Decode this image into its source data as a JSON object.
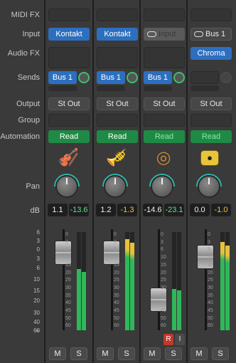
{
  "labels": {
    "midi_fx": "MIDI FX",
    "input": "Input",
    "audio_fx": "Audio FX",
    "sends": "Sends",
    "output": "Output",
    "group": "Group",
    "automation": "Automation",
    "pan": "Pan",
    "db": "dB"
  },
  "scale_marks": [
    "6",
    "3",
    "0",
    "3",
    "6",
    "10",
    "15",
    "20",
    "30",
    "40",
    "60",
    "∞"
  ],
  "fader_scale": [
    "0",
    "3",
    "6",
    "10",
    "15",
    "20",
    "25",
    "30",
    "35",
    "40",
    "45",
    "50",
    "60"
  ],
  "strips": [
    {
      "input": "Kontakt",
      "send": "Bus 1",
      "output": "St Out",
      "automation": "Read",
      "instrument_icon": "violin-icon",
      "volume": "1.1",
      "peak": "-13.6",
      "peak_color": "green",
      "fader_level_db": 1.1,
      "meter_level": 0.62,
      "mute": "M",
      "solo": "S"
    },
    {
      "input": "Kontakt",
      "send": "Bus 1",
      "output": "St Out",
      "automation": "Read",
      "instrument_icon": "brass-icon",
      "volume": "1.2",
      "peak": "-1.3",
      "peak_color": "yellow",
      "fader_level_db": 1.2,
      "meter_level": 0.93,
      "mute": "M",
      "solo": "S"
    },
    {
      "input": "Input",
      "send": "Bus 1",
      "output": "St Out",
      "automation": "Read",
      "instrument_icon": "tambourine-icon",
      "volume": "-14.6",
      "peak": "-23.1",
      "peak_color": "green",
      "fader_level_db": -14.6,
      "meter_level": 0.42,
      "record": "R",
      "input_monitor": "I",
      "mute": "M",
      "solo": "S"
    },
    {
      "input": "Bus 1",
      "audio_fx": "Chroma",
      "output": "St Out",
      "automation": "Read",
      "instrument_icon": "aux-icon",
      "volume": "0.0",
      "peak": "-1.0",
      "peak_color": "yellow",
      "fader_level_db": 0.0,
      "meter_level": 0.9,
      "mute": "M",
      "solo": "S"
    }
  ],
  "colors": {
    "blue": "#2d6fbf",
    "green": "#1f8a45",
    "peak_green": "#5fe08f",
    "peak_yellow": "#f0c040"
  }
}
